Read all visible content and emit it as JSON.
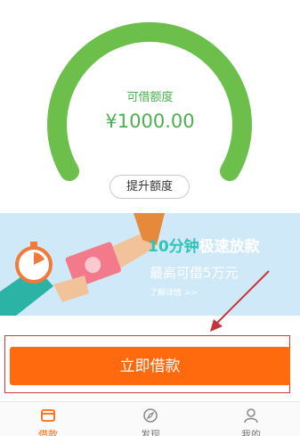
{
  "credit": {
    "label": "可借额度",
    "amount": "¥1000.00",
    "raise_button": "提升额度",
    "accent_color": "#6cbf4b"
  },
  "banner": {
    "headline_part1": "10分钟",
    "headline_part2": "极速放款",
    "subline": "最高可借5万元",
    "link": "了解详情 >>"
  },
  "cta": {
    "label": "立即借款",
    "color": "#ff6a0e"
  },
  "tabbar": {
    "items": [
      {
        "label": "借款",
        "icon": "wallet-icon",
        "active": true
      },
      {
        "label": "发现",
        "icon": "compass-icon",
        "active": false
      },
      {
        "label": "我的",
        "icon": "person-icon",
        "active": false
      }
    ]
  }
}
